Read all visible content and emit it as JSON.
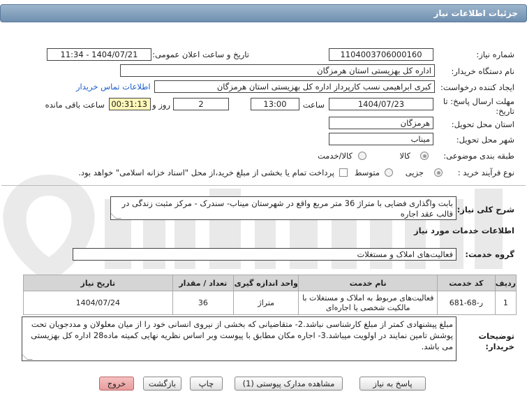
{
  "header": {
    "title": "جزئیات اطلاعات نیاز"
  },
  "need": {
    "number_label": "شماره نیاز:",
    "number": "1104003706000160",
    "announce_label": "تاریخ و ساعت اعلان عمومی:",
    "announce": "1404/07/21 - 11:34",
    "buyer_label": "نام دستگاه خریدار:",
    "buyer": "اداره کل بهزیستی استان هرمزگان",
    "creator_label": "ایجاد کننده درخواست:",
    "creator": "کبری  ابراهیمی نسب کارپرداز اداره کل بهزیستی استان هرمزگان",
    "contact_link": "اطلاعات تماس خریدار",
    "deadline_label": "مهلت ارسال پاسخ: تا تاریخ:",
    "deadline_date": "1404/07/23",
    "time_label": "ساعت",
    "deadline_time": "13:00",
    "days": "2",
    "days_label": "روز و",
    "remaining": "00:31:13",
    "remaining_label": "ساعت باقی مانده",
    "province_label": "استان محل تحویل:",
    "province": "هرمزگان",
    "city_label": "شهر محل تحویل:",
    "city": "میناب",
    "category_label": "طبقه بندی موضوعی:",
    "category_options": [
      "کالا",
      "کالا/خدمت"
    ],
    "process_label": "نوع فرآیند خرید :",
    "process_options": [
      "جزیی",
      "متوسط"
    ],
    "payment_note": "پرداخت تمام یا بخشی از مبلغ خرید،از محل \"اسناد خزانه اسلامی\" خواهد بود."
  },
  "description": {
    "label": "شرح کلی نیاز:",
    "text": "بابت واگذاری  فضایی با متراژ  36 متر مربع واقع در  شهرستان میناب- سندرک - مرکز مثبت زندگی در قالب عقد اجاره"
  },
  "services": {
    "section_title": "اطلاعات خدمات مورد نیاز",
    "group_label": "گروه خدمت:",
    "group": "فعالیت‌های  املاک و مستغلات",
    "columns": [
      "ردیف",
      "کد خدمت",
      "نام خدمت",
      "واحد اندازه گیری",
      "تعداد / مقدار",
      "تاریخ نیاز"
    ],
    "rows": [
      {
        "row": "1",
        "code": "ر-68-681",
        "name": "فعالیت‌های مربوط به املاک و مستغلات با مالکیت شخصی یا اجاره‌ای",
        "unit": "متراژ",
        "qty": "36",
        "date": "1404/07/24"
      }
    ]
  },
  "notes": {
    "label": "توضیحات خریدار:",
    "text": "مبلغ پیشنهادی کمتر از مبلغ کارشناسی نباشد.2- متقاضیانی که بخشی از نیروی انسانی خود را از میان معلولان و مددجویان تحت پوشش تامین نمایند در اولویت میباشد.3-  اجاره مکان  مطابق با پیوست وبر اساس نظریه نهایی کمیته ماده28 اداره کل بهزیستی می باشد."
  },
  "buttons": {
    "reply": "پاسخ به نیاز",
    "attachments": "مشاهده مدارک پیوستی (1)",
    "print": "چاپ",
    "back": "بازگشت",
    "exit": "خروج"
  },
  "colors": {
    "header": "#7f9dbc",
    "link": "#1a5ec9",
    "exit_button": "#eea9a9"
  }
}
